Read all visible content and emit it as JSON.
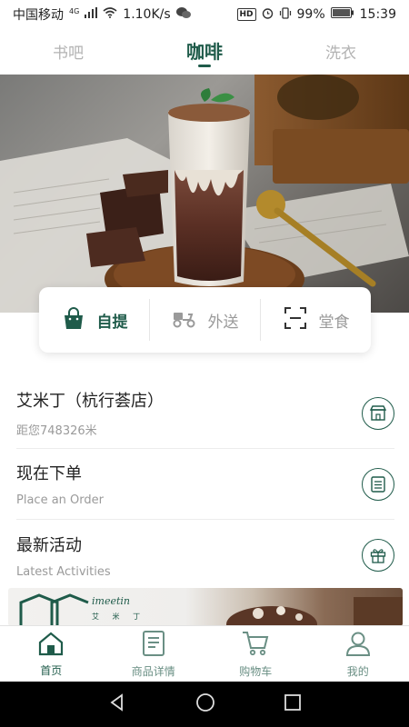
{
  "status_bar": {
    "carrier": "中国移动",
    "network": "4G",
    "speed": "1.10K/s",
    "hd": "HD",
    "battery": "99%",
    "time": "15:39"
  },
  "top_tabs": [
    {
      "label": "书吧",
      "active": false
    },
    {
      "label": "咖啡",
      "active": true
    },
    {
      "label": "洗衣",
      "active": false
    }
  ],
  "order_modes": [
    {
      "label": "自提",
      "icon": "shopping-bag-icon",
      "active": true
    },
    {
      "label": "外送",
      "icon": "scooter-icon",
      "active": false
    },
    {
      "label": "堂食",
      "icon": "scan-icon",
      "active": false
    }
  ],
  "info_rows": [
    {
      "title": "艾米丁（杭行荟店）",
      "subtitle": "距您748326米",
      "icon": "store-icon"
    },
    {
      "title": "现在下单",
      "subtitle": "Place an Order",
      "icon": "order-list-icon"
    },
    {
      "title": "最新活动",
      "subtitle": "Latest Activities",
      "icon": "gift-icon"
    }
  ],
  "promo": {
    "brand": "imeetin",
    "brand_cn": "艾 米 丁"
  },
  "bottom_nav": [
    {
      "label": "首页",
      "icon": "home-icon",
      "active": true
    },
    {
      "label": "商品详情",
      "icon": "document-icon",
      "active": false
    },
    {
      "label": "购物车",
      "icon": "cart-icon",
      "active": false
    },
    {
      "label": "我的",
      "icon": "user-icon",
      "active": false
    }
  ],
  "colors": {
    "accent": "#1f5b4a",
    "inactive_text": "#9a9a9a"
  }
}
